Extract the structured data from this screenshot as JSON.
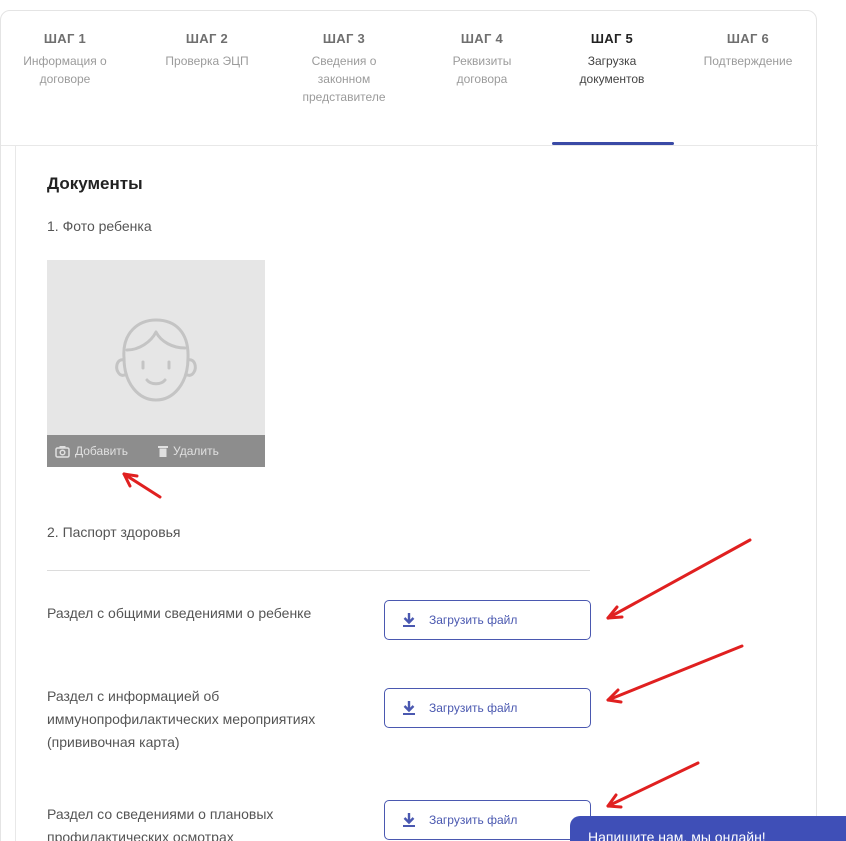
{
  "steps": [
    {
      "num": "ШАГ 1",
      "label": "Информация о договоре"
    },
    {
      "num": "ШАГ 2",
      "label": "Проверка ЭЦП"
    },
    {
      "num": "ШАГ 3",
      "label": "Сведения о законном представителе"
    },
    {
      "num": "ШАГ 4",
      "label": "Реквизиты договора"
    },
    {
      "num": "ШАГ 5",
      "label": "Загрузка документов"
    },
    {
      "num": "ШАГ 6",
      "label": "Подтверждение"
    }
  ],
  "active_step": 5,
  "documents": {
    "title": "Документы",
    "photo_heading": "1. Фото ребенка",
    "photo_add": "Добавить",
    "photo_delete": "Удалить",
    "passport_heading": "2. Паспорт здоровья",
    "sections": [
      {
        "text": "Раздел с общими сведениями о ребенке",
        "button": "Загрузить файл"
      },
      {
        "text": "Раздел с информацией об иммунопрофилактических мероприятиях (прививочная карта)",
        "button": "Загрузить файл"
      },
      {
        "text": "Раздел со сведениями о плановых профилактических осмотрах",
        "button": "Загрузить файл"
      }
    ]
  },
  "chat": {
    "label": "Напишите нам, мы онлайн!"
  },
  "colors": {
    "accent": "#3a4aa6",
    "arrow": "#e02020",
    "chat_bg": "#3f4fb7"
  }
}
